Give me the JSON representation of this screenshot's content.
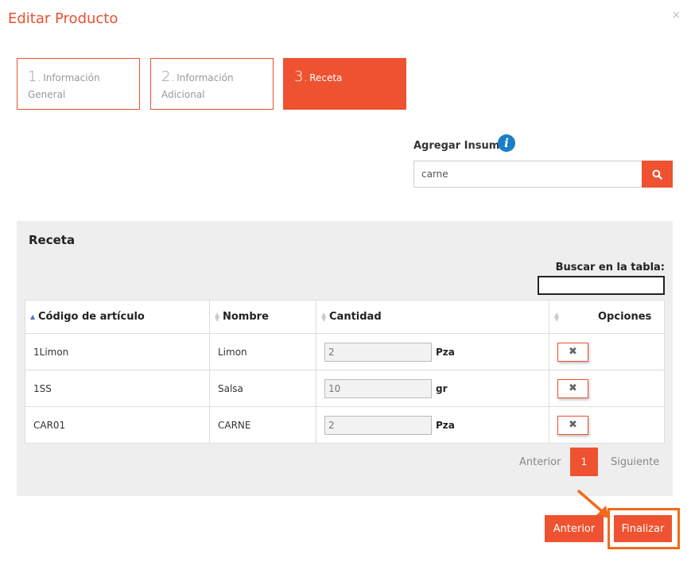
{
  "modal": {
    "title": "Editar Producto",
    "close_glyph": "×"
  },
  "steps": [
    {
      "num": "1.",
      "label": "Información General",
      "active": false
    },
    {
      "num": "2.",
      "label": "Información Adicional",
      "active": false
    },
    {
      "num": "3.",
      "label": "Receta",
      "active": true
    }
  ],
  "add_supplies": {
    "label": "Agregar Insumos",
    "info_glyph": "i",
    "search_value": "carne"
  },
  "recipe": {
    "title": "Receta",
    "filter_label": "Buscar en la tabla:",
    "filter_value": "",
    "columns": [
      "Código de artículo",
      "Nombre",
      "Cantidad",
      "Opciones"
    ],
    "rows": [
      {
        "code": "1Limon",
        "name": "Limon",
        "qty": "2",
        "unit": "Pza"
      },
      {
        "code": "1SS",
        "name": "Salsa",
        "qty": "10",
        "unit": "gr"
      },
      {
        "code": "CAR01",
        "name": "CARNE",
        "qty": "2",
        "unit": "Pza"
      }
    ],
    "delete_glyph": "✖",
    "pager": {
      "prev": "Anterior",
      "page": "1",
      "next": "Siguiente"
    }
  },
  "footer": {
    "prev_label": "Anterior",
    "finish_label": "Finalizar"
  },
  "colors": {
    "accent": "#ef5230",
    "info": "#1a7fc4",
    "highlight": "#f26a1b"
  }
}
